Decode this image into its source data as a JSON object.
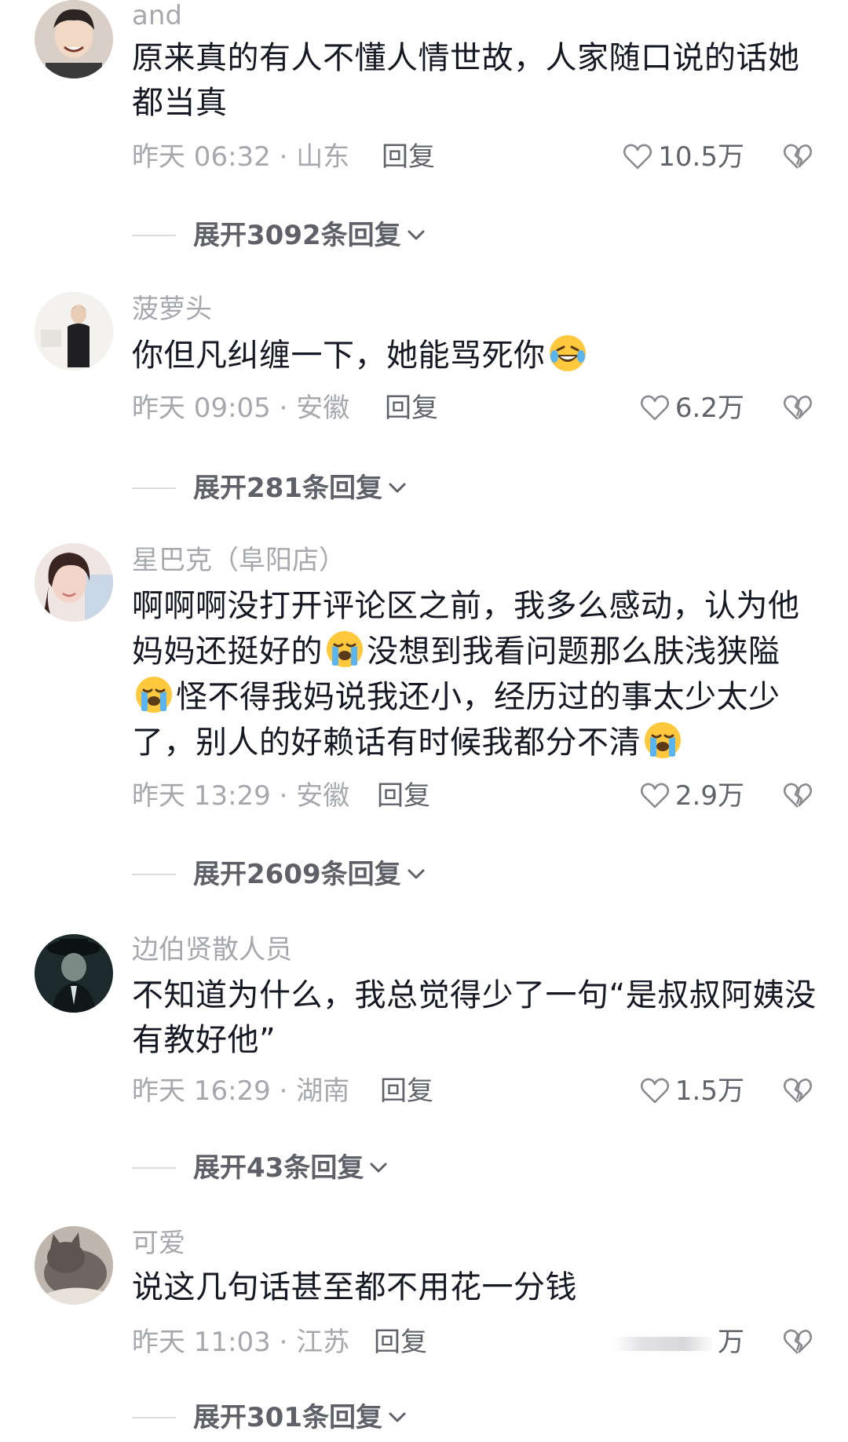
{
  "comments": [
    {
      "username": "and",
      "text": "原来真的有人不懂人情世故，人家随口说的话她都当真",
      "time_location": "昨天 06:32 · 山东",
      "reply_label": "回复",
      "likes": "10.5万",
      "expand_label": "展开3092条回复",
      "avatar_icon": "person-photo"
    },
    {
      "username": "菠萝头",
      "text_parts": [
        "你但凡纠缠一下，她能骂死你"
      ],
      "emoji": "rolling-on-floor-laughing-emoji",
      "time_location": "昨天 09:05 · 安徽",
      "reply_label": "回复",
      "likes": "6.2万",
      "expand_label": "展开281条回复",
      "avatar_icon": "person-photo"
    },
    {
      "username": "星巴克（阜阳店）",
      "text_parts": [
        "啊啊啊没打开评论区之前，我多么感动，认为他妈妈还挺好的",
        "没想到我看问题那么肤浅狭隘",
        "怪不得我妈说我还小，经历过的事太少太少了，别人的好赖话有时候我都分不清"
      ],
      "emoji": "loudly-crying-emoji",
      "time_location": "昨天 13:29 · 安徽",
      "reply_label": "回复",
      "likes": "2.9万",
      "expand_label": "展开2609条回复",
      "avatar_icon": "person-photo"
    },
    {
      "username": "边伯贤散人员",
      "text": "不知道为什么，我总觉得少了一句“是叔叔阿姨没有教好他”",
      "time_location": "昨天 16:29 · 湖南",
      "reply_label": "回复",
      "likes": "1.5万",
      "expand_label": "展开43条回复",
      "avatar_icon": "person-photo"
    },
    {
      "username": "可爱",
      "text": "说这几句话甚至都不用花一分钱",
      "time_location": "昨天 11:03 · 江苏",
      "reply_label": "回复",
      "likes": "万",
      "expand_label": "展开301条回复",
      "avatar_icon": "cat-photo"
    }
  ],
  "icons": {
    "like": "heart-outline-icon",
    "dislike": "broken-heart-icon",
    "expand": "chevron-down-icon"
  },
  "colors": {
    "text": "#161823",
    "meta": "#a6a8ad",
    "action": "#61636b"
  }
}
